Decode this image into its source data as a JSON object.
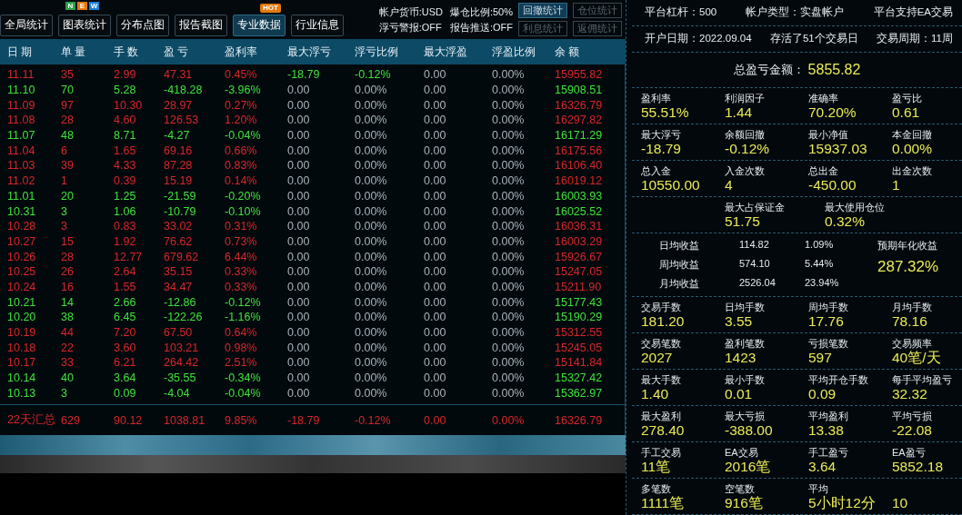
{
  "toolbar": {
    "buttons": [
      {
        "label": "全局统计",
        "selected": false
      },
      {
        "label": "图表统计",
        "selected": false,
        "badge_letters": [
          "N",
          "E",
          "W"
        ]
      },
      {
        "label": "分布点图",
        "selected": false
      },
      {
        "label": "报告截图",
        "selected": false
      },
      {
        "label": "专业数据",
        "selected": true,
        "badge": "HOT"
      },
      {
        "label": "行业信息",
        "selected": false
      }
    ],
    "info": [
      "帐户货币:USD",
      "爆仓比例:50%",
      "浮亏警报:OFF",
      "报告推送:OFF"
    ],
    "side_buttons": [
      {
        "label": "回撤统计",
        "disabled": false
      },
      {
        "label": "仓位统计",
        "disabled": true
      },
      {
        "label": "利息统计",
        "disabled": true
      },
      {
        "label": "返佣统计",
        "disabled": true
      }
    ]
  },
  "table": {
    "columns": [
      "日 期",
      "单 量",
      "手 数",
      "盈 亏",
      "盈利率",
      "最大浮亏",
      "浮亏比例",
      "最大浮盈",
      "浮盈比例",
      "余 额"
    ],
    "rows": [
      {
        "kind": "up",
        "float_loss": true,
        "cells": [
          "11.11",
          "35",
          "2.99",
          "47.31",
          "0.45%",
          "-18.79",
          "-0.12%",
          "0.00",
          "0.00%",
          "15955.82"
        ]
      },
      {
        "kind": "down",
        "float_loss": false,
        "cells": [
          "11.10",
          "70",
          "5.28",
          "-418.28",
          "-3.96%",
          "0.00",
          "0.00%",
          "0.00",
          "0.00%",
          "15908.51"
        ]
      },
      {
        "kind": "up",
        "float_loss": false,
        "cells": [
          "11.09",
          "97",
          "10.30",
          "28.97",
          "0.27%",
          "0.00",
          "0.00%",
          "0.00",
          "0.00%",
          "16326.79"
        ]
      },
      {
        "kind": "up",
        "float_loss": false,
        "cells": [
          "11.08",
          "28",
          "4.60",
          "126.53",
          "1.20%",
          "0.00",
          "0.00%",
          "0.00",
          "0.00%",
          "16297.82"
        ]
      },
      {
        "kind": "down",
        "float_loss": false,
        "cells": [
          "11.07",
          "48",
          "8.71",
          "-4.27",
          "-0.04%",
          "0.00",
          "0.00%",
          "0.00",
          "0.00%",
          "16171.29"
        ]
      },
      {
        "kind": "up",
        "float_loss": false,
        "cells": [
          "11.04",
          "6",
          "1.65",
          "69.16",
          "0.66%",
          "0.00",
          "0.00%",
          "0.00",
          "0.00%",
          "16175.56"
        ]
      },
      {
        "kind": "up",
        "float_loss": false,
        "cells": [
          "11.03",
          "39",
          "4.33",
          "87.28",
          "0.83%",
          "0.00",
          "0.00%",
          "0.00",
          "0.00%",
          "16106.40"
        ]
      },
      {
        "kind": "up",
        "float_loss": false,
        "cells": [
          "11.02",
          "1",
          "0.39",
          "15.19",
          "0.14%",
          "0.00",
          "0.00%",
          "0.00",
          "0.00%",
          "16019.12"
        ]
      },
      {
        "kind": "down",
        "float_loss": false,
        "cells": [
          "11.01",
          "20",
          "1.25",
          "-21.59",
          "-0.20%",
          "0.00",
          "0.00%",
          "0.00",
          "0.00%",
          "16003.93"
        ]
      },
      {
        "kind": "down",
        "float_loss": false,
        "cells": [
          "10.31",
          "3",
          "1.06",
          "-10.79",
          "-0.10%",
          "0.00",
          "0.00%",
          "0.00",
          "0.00%",
          "16025.52"
        ]
      },
      {
        "kind": "up",
        "float_loss": false,
        "cells": [
          "10.28",
          "3",
          "0.83",
          "33.02",
          "0.31%",
          "0.00",
          "0.00%",
          "0.00",
          "0.00%",
          "16036.31"
        ]
      },
      {
        "kind": "up",
        "float_loss": false,
        "cells": [
          "10.27",
          "15",
          "1.92",
          "76.62",
          "0.73%",
          "0.00",
          "0.00%",
          "0.00",
          "0.00%",
          "16003.29"
        ]
      },
      {
        "kind": "up",
        "float_loss": false,
        "cells": [
          "10.26",
          "28",
          "12.77",
          "679.62",
          "6.44%",
          "0.00",
          "0.00%",
          "0.00",
          "0.00%",
          "15926.67"
        ]
      },
      {
        "kind": "up",
        "float_loss": false,
        "cells": [
          "10.25",
          "26",
          "2.64",
          "35.15",
          "0.33%",
          "0.00",
          "0.00%",
          "0.00",
          "0.00%",
          "15247.05"
        ]
      },
      {
        "kind": "up",
        "float_loss": false,
        "cells": [
          "10.24",
          "16",
          "1.55",
          "34.47",
          "0.33%",
          "0.00",
          "0.00%",
          "0.00",
          "0.00%",
          "15211.90"
        ]
      },
      {
        "kind": "down",
        "float_loss": false,
        "cells": [
          "10.21",
          "14",
          "2.66",
          "-12.86",
          "-0.12%",
          "0.00",
          "0.00%",
          "0.00",
          "0.00%",
          "15177.43"
        ]
      },
      {
        "kind": "down",
        "float_loss": false,
        "cells": [
          "10.20",
          "38",
          "6.45",
          "-122.26",
          "-1.16%",
          "0.00",
          "0.00%",
          "0.00",
          "0.00%",
          "15190.29"
        ]
      },
      {
        "kind": "up",
        "float_loss": false,
        "cells": [
          "10.19",
          "44",
          "7.20",
          "67.50",
          "0.64%",
          "0.00",
          "0.00%",
          "0.00",
          "0.00%",
          "15312.55"
        ]
      },
      {
        "kind": "up",
        "float_loss": false,
        "cells": [
          "10.18",
          "22",
          "3.60",
          "103.21",
          "0.98%",
          "0.00",
          "0.00%",
          "0.00",
          "0.00%",
          "15245.05"
        ]
      },
      {
        "kind": "up",
        "float_loss": false,
        "cells": [
          "10.17",
          "33",
          "6.21",
          "264.42",
          "2.51%",
          "0.00",
          "0.00%",
          "0.00",
          "0.00%",
          "15141.84"
        ]
      },
      {
        "kind": "down",
        "float_loss": false,
        "cells": [
          "10.14",
          "40",
          "3.64",
          "-35.55",
          "-0.34%",
          "0.00",
          "0.00%",
          "0.00",
          "0.00%",
          "15327.42"
        ]
      },
      {
        "kind": "down",
        "float_loss": false,
        "cells": [
          "10.13",
          "3",
          "0.09",
          "-4.04",
          "-0.04%",
          "0.00",
          "0.00%",
          "0.00",
          "0.00%",
          "15362.97"
        ]
      }
    ],
    "summary": {
      "kind": "up",
      "cells": [
        "22天汇总",
        "629",
        "90.12",
        "1038.81",
        "9.85%",
        "-18.79",
        "-0.12%",
        "0.00",
        "0.00%",
        "16326.79"
      ]
    }
  },
  "account": {
    "info_rows": [
      [
        "平台杠杆：500",
        "帐户类型：实盘帐户",
        "平台支持EA交易"
      ],
      [
        "开户日期：2022.09.04",
        "存活了51个交易日",
        "交易周期：11周"
      ]
    ],
    "total": {
      "label": "总盈亏金额：",
      "value": "5855.82"
    },
    "stat_rows_top": [
      [
        {
          "label": "盈利率",
          "value": "55.51%"
        },
        {
          "label": "利润因子",
          "value": "1.44"
        },
        {
          "label": "准确率",
          "value": "70.20%"
        },
        {
          "label": "盈亏比",
          "value": "0.61"
        }
      ],
      [
        {
          "label": "最大浮亏",
          "value": "-18.79"
        },
        {
          "label": "余额回撤",
          "value": "-0.12%"
        },
        {
          "label": "最小净值",
          "value": "15937.03"
        },
        {
          "label": "本金回撤",
          "value": "0.00%"
        }
      ],
      [
        {
          "label": "总入金",
          "value": "10550.00"
        },
        {
          "label": "入金次数",
          "value": "4"
        },
        {
          "label": "总出金",
          "value": "-450.00"
        },
        {
          "label": "出金次数",
          "value": "1"
        }
      ],
      [
        {
          "label": "最大占保证金",
          "value": "51.75"
        },
        {
          "label": "最大使用仓位",
          "value": "0.32%"
        }
      ]
    ],
    "averages": [
      {
        "label": "日均收益",
        "value": "114.82",
        "percent": "1.09%"
      },
      {
        "label": "周均收益",
        "value": "574.10",
        "percent": "5.44%"
      },
      {
        "label": "月均收益",
        "value": "2526.04",
        "percent": "23.94%"
      }
    ],
    "expected": {
      "label": "预期年化收益",
      "value": "287.32%"
    },
    "stat_rows_bottom": [
      [
        {
          "label": "交易手数",
          "value": "181.20"
        },
        {
          "label": "日均手数",
          "value": "3.55"
        },
        {
          "label": "周均手数",
          "value": "17.76"
        },
        {
          "label": "月均手数",
          "value": "78.16"
        }
      ],
      [
        {
          "label": "交易笔数",
          "value": "2027"
        },
        {
          "label": "盈利笔数",
          "value": "1423"
        },
        {
          "label": "亏损笔数",
          "value": "597"
        },
        {
          "label": "交易频率",
          "value": "40笔/天"
        }
      ],
      [
        {
          "label": "最大手数",
          "value": "1.40"
        },
        {
          "label": "最小手数",
          "value": "0.01"
        },
        {
          "label": "平均开仓手数",
          "value": "0.09"
        },
        {
          "label": "每手平均盈亏",
          "value": "32.32"
        }
      ],
      [
        {
          "label": "最大盈利",
          "value": "278.40"
        },
        {
          "label": "最大亏损",
          "value": "-388.00"
        },
        {
          "label": "平均盈利",
          "value": "13.38"
        },
        {
          "label": "平均亏损",
          "value": "-22.08"
        }
      ],
      [
        {
          "label": "手工交易",
          "value": "11笔"
        },
        {
          "label": "EA交易",
          "value": "2016笔"
        },
        {
          "label": "手工盈亏",
          "value": "3.64"
        },
        {
          "label": "EA盈亏",
          "value": "5852.18"
        }
      ],
      [
        {
          "label": "多笔数",
          "value": "1111笔"
        },
        {
          "label": "空笔数",
          "value": "916笔"
        },
        {
          "label": "平均",
          "value": "5小时12分"
        },
        {
          "value": "10"
        }
      ]
    ]
  }
}
